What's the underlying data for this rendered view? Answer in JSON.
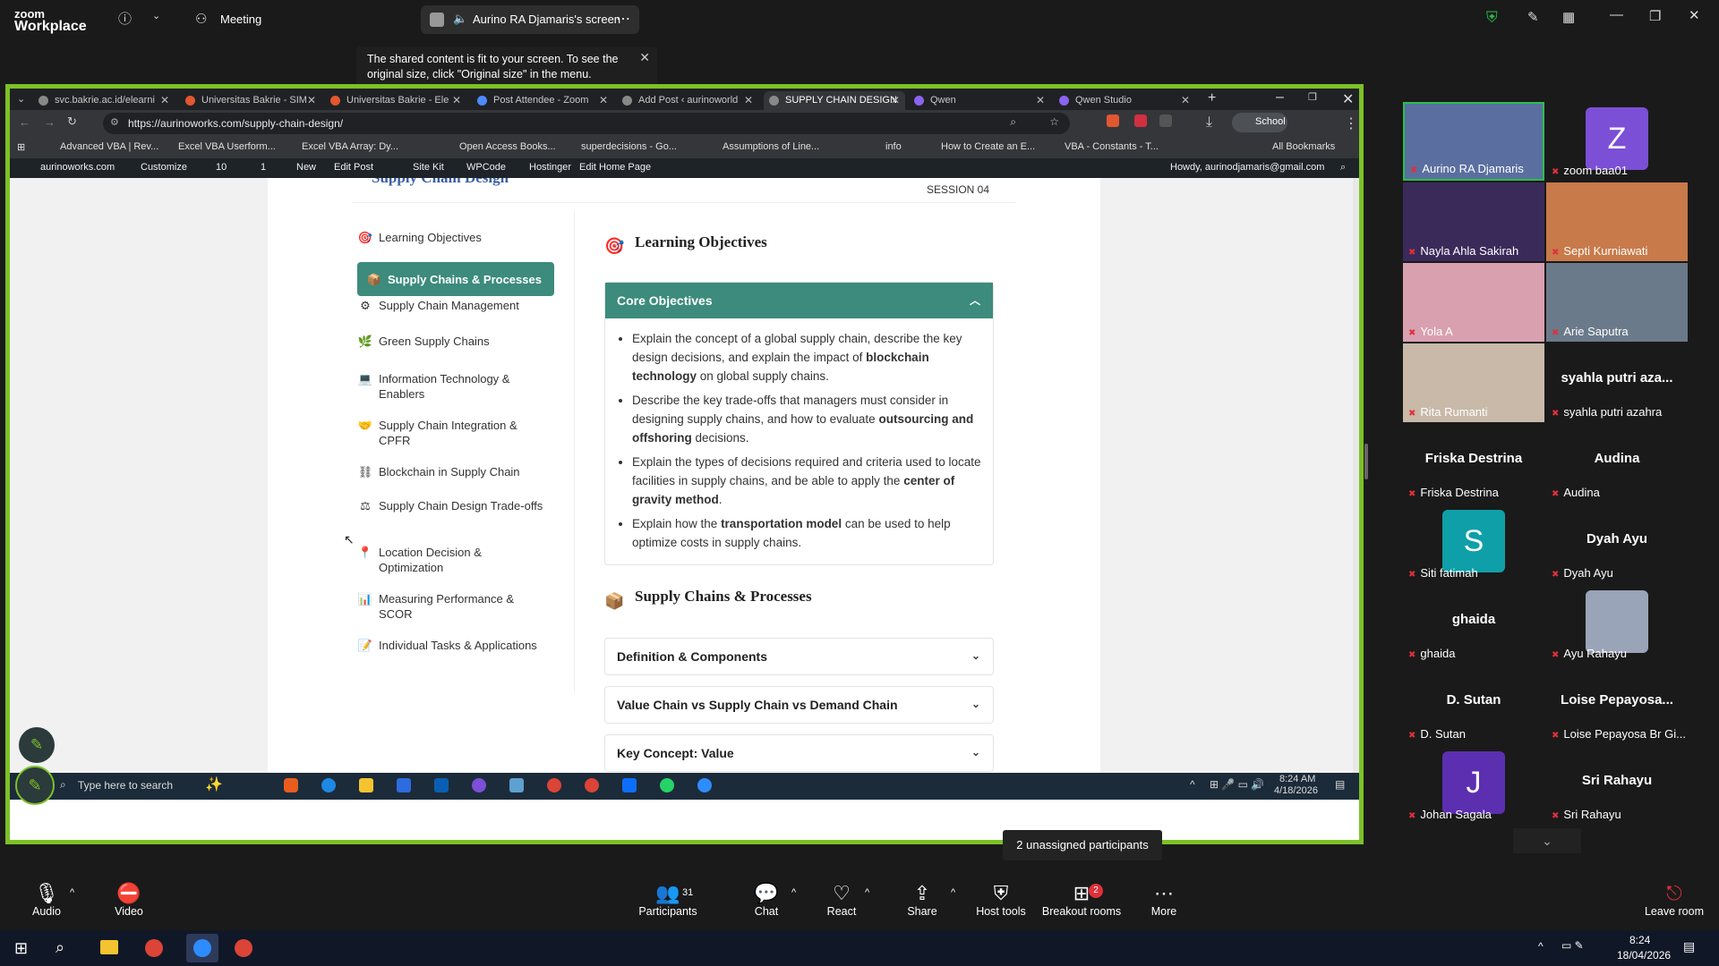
{
  "zoom": {
    "brand_top": "zoom",
    "brand_bottom": "Workplace",
    "meeting_label": "Meeting",
    "screen_label": "Aurino RA Djamaris's screen",
    "toast_text": "The shared content is fit to your screen. To see the original size, click \"Original size\" in the menu.",
    "unassigned": "2 unassigned participants",
    "participants_count": "31",
    "breakout_badge": "2",
    "toolbar": [
      {
        "label": "Audio",
        "icon": "microphone-icon"
      },
      {
        "label": "Video",
        "icon": "camera-off-icon"
      },
      {
        "label": "Participants",
        "icon": "people-icon"
      },
      {
        "label": "Chat",
        "icon": "chat-icon"
      },
      {
        "label": "React",
        "icon": "heart-icon"
      },
      {
        "label": "Share",
        "icon": "share-icon"
      },
      {
        "label": "Host tools",
        "icon": "shield-icon"
      },
      {
        "label": "Breakout rooms",
        "icon": "grid-icon"
      },
      {
        "label": "More",
        "icon": "more-icon"
      },
      {
        "label": "Leave room",
        "icon": "leave-icon"
      }
    ]
  },
  "browser": {
    "tabs": [
      {
        "title": "svc.bakrie.ac.id/elearni",
        "color": "#888"
      },
      {
        "title": "Universitas Bakrie - SIM",
        "color": "#e2572f"
      },
      {
        "title": "Universitas Bakrie - Ele",
        "color": "#e2572f"
      },
      {
        "title": "Post Attendee - Zoom",
        "color": "#4a8cff"
      },
      {
        "title": "Add Post ‹ aurinoworld",
        "color": "#888"
      },
      {
        "title": "SUPPLY CHAIN DESIGN",
        "color": "#888"
      },
      {
        "title": "Qwen",
        "color": "#8a63f0"
      },
      {
        "title": "Qwen Studio",
        "color": "#8a63f0"
      }
    ],
    "url": "https://aurinoworks.com/supply-chain-design/",
    "profile": "School",
    "bookmarks": [
      "Advanced VBA | Rev...",
      "Excel VBA Userform...",
      "Excel VBA Array: Dy...",
      "Open Access Books...",
      "superdecisions - Go...",
      "Assumptions of Line...",
      "info",
      "How to Create an E...",
      "VBA - Constants - T...",
      "All Bookmarks"
    ],
    "wp_bar": [
      "aurinoworks.com",
      "Customize",
      "10",
      "1",
      "New",
      "Edit Post",
      "Site Kit",
      "WPCode",
      "Hostinger",
      "Edit Home Page"
    ],
    "wp_howdy": "Howdy, aurinodjamaris@gmail.com"
  },
  "page": {
    "header_title": "Supply Chain Design",
    "session": "SESSION 04",
    "nav": [
      {
        "label": "Learning Objectives",
        "icon": "🎯"
      },
      {
        "label": "Supply Chains & Processes",
        "icon": "📦"
      },
      {
        "label": "Supply Chain Management",
        "icon": "⚙"
      },
      {
        "label": "Green Supply Chains",
        "icon": "🌿"
      },
      {
        "label": "Information Technology & Enablers",
        "icon": "💻"
      },
      {
        "label": "Supply Chain Integration & CPFR",
        "icon": "🤝"
      },
      {
        "label": "Blockchain in Supply Chain",
        "icon": "⛓"
      },
      {
        "label": "Supply Chain Design Trade-offs",
        "icon": "⚖"
      },
      {
        "label": "Location Decision & Optimization",
        "icon": "📍"
      },
      {
        "label": "Measuring Performance & SCOR",
        "icon": "📊"
      },
      {
        "label": "Individual Tasks & Applications",
        "icon": "📝"
      }
    ],
    "section1_title": "Learning Objectives",
    "core_title": "Core Objectives",
    "bullets": [
      {
        "pre": "Explain the concept of a global supply chain, describe the key design decisions, and explain the impact of ",
        "bold": "blockchain technology",
        "post": " on global supply chains."
      },
      {
        "pre": "Describe the key trade-offs that managers must consider in designing supply chains, and how to evaluate ",
        "bold": "outsourcing and offshoring",
        "post": " decisions."
      },
      {
        "pre": "Explain the types of decisions required and criteria used to locate facilities in supply chains, and be able to apply the ",
        "bold": "center of gravity method",
        "post": "."
      },
      {
        "pre": "Explain how the ",
        "bold": "transportation model",
        "post": " can be used to help optimize costs in supply chains."
      }
    ],
    "section2_title": "Supply Chains & Processes",
    "accordions": [
      "Definition & Components",
      "Value Chain vs Supply Chain vs Demand Chain",
      "Key Concept: Value"
    ]
  },
  "inner_taskbar": {
    "search_placeholder": "Type here to search",
    "time": "8:24 AM",
    "date": "4/18/2026"
  },
  "gallery": [
    {
      "name": "Aurino RA Djamaris",
      "kind": "video",
      "color": "#5a6fa0"
    },
    {
      "name": "zoom baa01",
      "kind": "avatar",
      "letter": "Z",
      "color": "#7b4fd6"
    },
    {
      "name": "Nayla Ahla Sakirah",
      "kind": "video",
      "color": "#3a2a5a"
    },
    {
      "name": "Septi Kurniawati",
      "kind": "video",
      "color": "#c87a4a"
    },
    {
      "name": "Yola A",
      "kind": "video",
      "color": "#d9a0b0"
    },
    {
      "name": "Arie Saputra",
      "kind": "video",
      "color": "#6a7a8a"
    },
    {
      "name": "Rita Rumanti",
      "kind": "video",
      "color": "#c9b9a9"
    },
    {
      "name": "syahla putri azahra",
      "kind": "text",
      "big": "syahla putri aza..."
    },
    {
      "name": "Friska Destrina",
      "kind": "text",
      "big": "Friska Destrina"
    },
    {
      "name": "Audina",
      "kind": "text",
      "big": "Audina"
    },
    {
      "name": "Siti fatimah",
      "kind": "avatar",
      "letter": "S",
      "color": "#0f9fa8"
    },
    {
      "name": "Dyah Ayu",
      "kind": "text",
      "big": "Dyah Ayu"
    },
    {
      "name": "ghaida",
      "kind": "text",
      "big": "ghaida"
    },
    {
      "name": "Ayu Rahayu",
      "kind": "photo",
      "color": "#9aa4b8"
    },
    {
      "name": "D. Sutan",
      "kind": "text",
      "big": "D. Sutan"
    },
    {
      "name": "Loise Pepayosa Br Gi...",
      "kind": "text",
      "big": "Loise  Pepayosa..."
    },
    {
      "name": "Johan Sagala",
      "kind": "avatar",
      "letter": "J",
      "color": "#5b2fb0"
    },
    {
      "name": "Sri Rahayu",
      "kind": "text",
      "big": "Sri Rahayu"
    }
  ],
  "win_taskbar": {
    "time": "8:24",
    "date": "18/04/2026"
  }
}
